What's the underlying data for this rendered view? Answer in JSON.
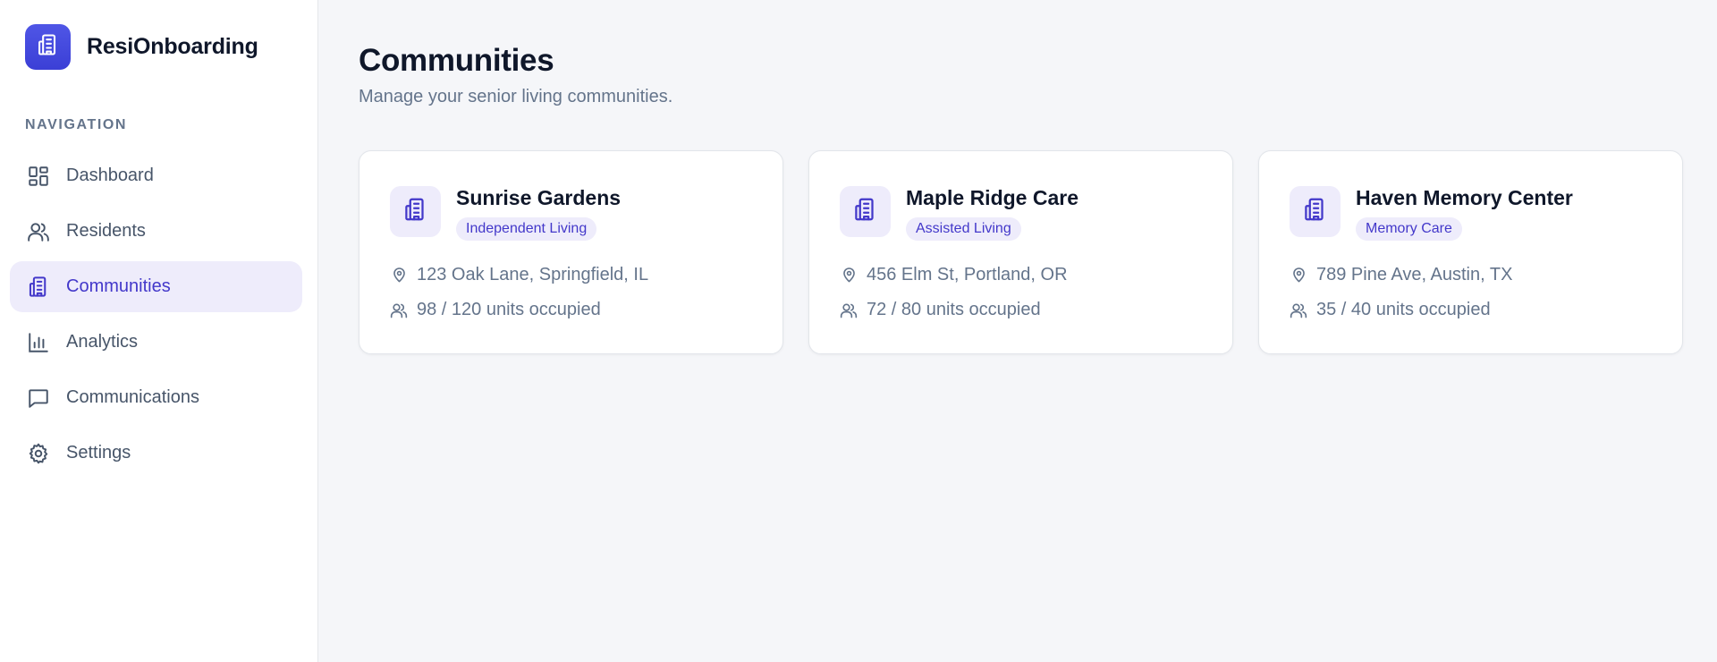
{
  "brand": {
    "name": "ResiOnboarding",
    "icon": "building-icon"
  },
  "sidebar": {
    "heading": "NAVIGATION",
    "items": [
      {
        "label": "Dashboard",
        "icon": "dashboard-icon",
        "active": false
      },
      {
        "label": "Residents",
        "icon": "users-icon",
        "active": false
      },
      {
        "label": "Communities",
        "icon": "building-icon",
        "active": true
      },
      {
        "label": "Analytics",
        "icon": "bar-chart-icon",
        "active": false
      },
      {
        "label": "Communications",
        "icon": "message-icon",
        "active": false
      },
      {
        "label": "Settings",
        "icon": "gear-icon",
        "active": false
      }
    ]
  },
  "page": {
    "title": "Communities",
    "subtitle": "Manage your senior living communities."
  },
  "communities": [
    {
      "name": "Sunrise Gardens",
      "type": "Independent Living",
      "address": "123 Oak Lane, Springfield, IL",
      "occupancy": "98 / 120 units occupied"
    },
    {
      "name": "Maple Ridge Care",
      "type": "Assisted Living",
      "address": "456 Elm St, Portland, OR",
      "occupancy": "72 / 80 units occupied"
    },
    {
      "name": "Haven Memory Center",
      "type": "Memory Care",
      "address": "789 Pine Ave, Austin, TX",
      "occupancy": "35 / 40 units occupied"
    }
  ],
  "colors": {
    "accent": "#4338ca",
    "accent_bg": "#eeecfb",
    "brand_gradient_top": "#4f56e6",
    "page_bg": "#f5f6f9",
    "muted_text": "#64748b"
  }
}
